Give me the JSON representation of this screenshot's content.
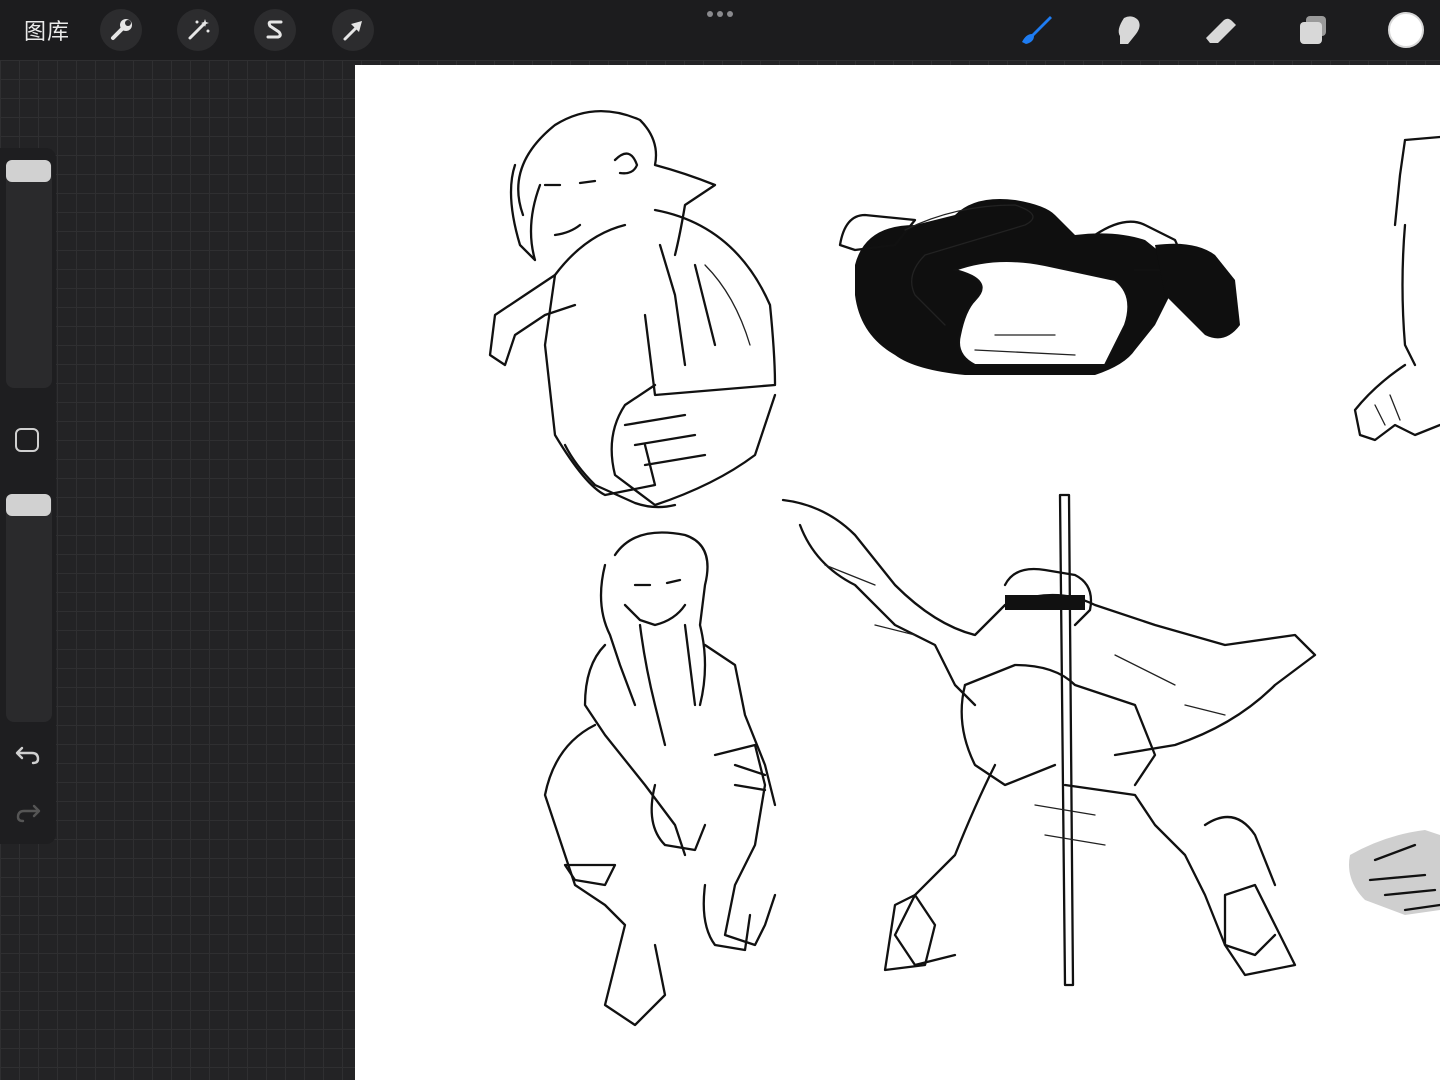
{
  "toolbar": {
    "gallery_label": "图库",
    "left_tools": [
      {
        "name": "actions",
        "icon": "wrench-icon"
      },
      {
        "name": "adjustments",
        "icon": "magic-wand-icon"
      },
      {
        "name": "selection",
        "icon": "selection-s-icon"
      },
      {
        "name": "transform",
        "icon": "arrow-cursor-icon"
      }
    ],
    "right_tools": [
      {
        "name": "brush",
        "icon": "brush-icon",
        "active": true
      },
      {
        "name": "smudge",
        "icon": "smudge-icon"
      },
      {
        "name": "eraser",
        "icon": "eraser-icon"
      },
      {
        "name": "layers",
        "icon": "layers-icon"
      }
    ],
    "current_color": "#ffffff",
    "accent_color": "#1e7cf2"
  },
  "sidebar": {
    "brush_size_slider": 0.0,
    "opacity_slider": 0.0,
    "modify_button": "square-modify-icon",
    "undo_icon": "undo-icon",
    "redo_icon": "redo-icon"
  },
  "canvas": {
    "background": "#ffffff",
    "content": "sketch-figures"
  }
}
